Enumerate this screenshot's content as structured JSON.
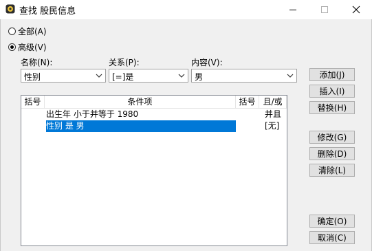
{
  "window": {
    "title": "查找 股民信息"
  },
  "radios": [
    {
      "label": "全部(A)",
      "checked": false
    },
    {
      "label": "高级(V)",
      "checked": true
    }
  ],
  "fields": {
    "name_label": "名称(N):",
    "relation_label": "关系(P):",
    "content_label": "内容(V):",
    "name_value": "性别",
    "relation_value": "[=]是",
    "content_value": "男"
  },
  "table": {
    "headers": [
      "括号",
      "条件项",
      "括号",
      "且/或"
    ],
    "rows": [
      {
        "lbracket": "",
        "condition": "出生年 小于并等于 1980",
        "rbracket": "",
        "logic": "并且",
        "selected": false
      },
      {
        "lbracket": "",
        "condition": "性别 是 男",
        "rbracket": "",
        "logic": "[无]",
        "selected": true
      }
    ]
  },
  "buttons": {
    "add": "添加(J)",
    "insert": "插入(I)",
    "replace": "替换(H)",
    "modify": "修改(G)",
    "delete": "删除(D)",
    "clear": "清除(L)",
    "ok": "确定(O)",
    "cancel": "取消(C)"
  },
  "colors": {
    "selection": "#0078d7"
  }
}
